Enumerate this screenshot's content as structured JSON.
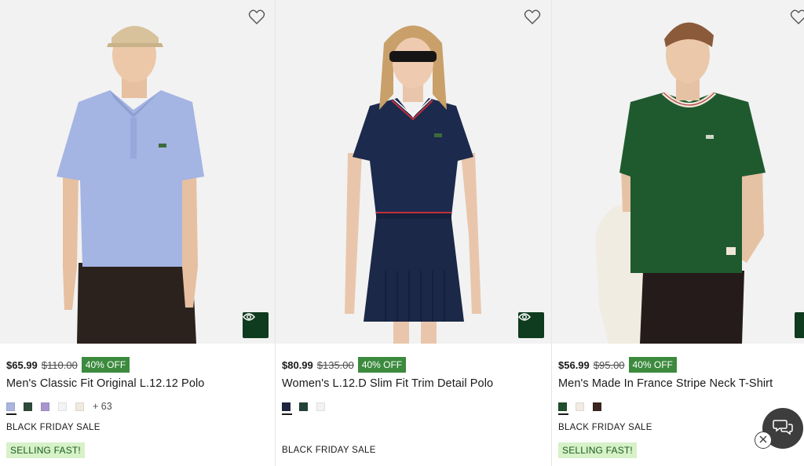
{
  "products": [
    {
      "price": "$65.99",
      "old_price": "$110.00",
      "discount": "40% OFF",
      "name": "Men's Classic Fit Original L.12.12 Polo",
      "swatches": [
        "#a9b4df",
        "#2f4a3b",
        "#a895cf",
        "#f4f4f4",
        "#efe9df"
      ],
      "more_colors": "+ 63",
      "promo": "BLACK FRIDAY SALE",
      "badge": "SELLING FAST!"
    },
    {
      "price": "$80.99",
      "old_price": "$135.00",
      "discount": "40% OFF",
      "name": "Women's L.12.D Slim Fit Trim Detail Polo",
      "swatches": [
        "#1e2540",
        "#234338",
        "#f2f2f2"
      ],
      "promo": "BLACK FRIDAY SALE"
    },
    {
      "price": "$56.99",
      "old_price": "$95.00",
      "discount": "40% OFF",
      "name": "Men's Made In France Stripe Neck T-Shirt",
      "swatches": [
        "#1f4f2c",
        "#f1ebe3",
        "#3b2622"
      ],
      "promo": "BLACK FRIDAY SALE",
      "badge": "SELLING FAST!"
    }
  ],
  "colors": {
    "accent_green": "#0f3b1f",
    "discount_bg": "#3b8a3d",
    "badge_bg": "#d7f1c9",
    "badge_text": "#1a5d1f",
    "image_bg": "#f2f2f2"
  },
  "icons": {
    "wishlist": "heart-outline-icon",
    "quick_view": "eye-icon",
    "chat": "chat-bubbles-icon",
    "close": "close-icon"
  }
}
